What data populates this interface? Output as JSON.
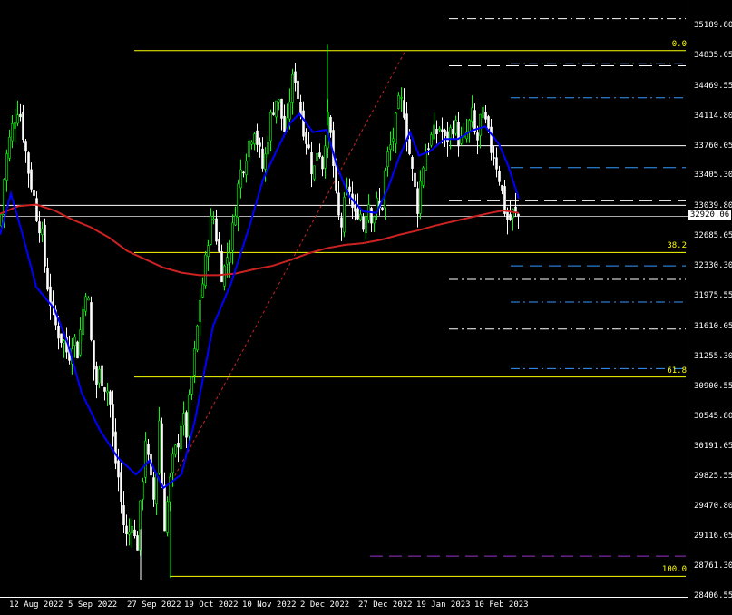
{
  "chart_data": {
    "type": "candlestick",
    "title": "",
    "ylim": [
      28406.55,
      35460
    ],
    "price_axis": {
      "ticks": [
        "35189.80",
        "34835.05",
        "34469.55",
        "34114.80",
        "33760.05",
        "33405.30",
        "33039.80",
        "32685.05",
        "32330.30",
        "31975.55",
        "31610.05",
        "31255.30",
        "30900.55",
        "30545.80",
        "30191.05",
        "29825.55",
        "29470.80",
        "29116.05",
        "28761.30",
        "28406.55"
      ]
    },
    "time_axis": {
      "ticks": [
        "12 Aug 2022",
        "5 Sep 2022",
        "27 Sep 2022",
        "19 Oct 2022",
        "10 Nov 2022",
        "2 Dec 2022",
        "27 Dec 2022",
        "19 Jan 2023",
        "10 Feb 2023"
      ]
    },
    "current_price": "32920.06",
    "fibonacci": {
      "levels": [
        {
          "label": "0.0",
          "price": 34890
        },
        {
          "label": "38.2",
          "price": 32490
        },
        {
          "label": "61.8",
          "price": 31010
        },
        {
          "label": "100.0",
          "price": 28640
        }
      ],
      "color": "#ffff00"
    },
    "horizontal_levels": [
      {
        "price": 35270,
        "style": "dashdot",
        "color": "#ffffff"
      },
      {
        "price": 34740,
        "style": "dashdot",
        "color": "#8899ff"
      },
      {
        "price": 34710,
        "style": "dash",
        "color": "#ffffff"
      },
      {
        "price": 34330,
        "style": "dashdot",
        "color": "#3399ff"
      },
      {
        "price": 33760,
        "style": "solid",
        "color": "#ffffff"
      },
      {
        "price": 33500,
        "style": "dash",
        "color": "#3399ff"
      },
      {
        "price": 33105,
        "style": "dash",
        "color": "#ffffff"
      },
      {
        "price": 33050,
        "style": "solid",
        "color": "#ffffff"
      },
      {
        "price": 32330,
        "style": "dash",
        "color": "#3399ff"
      },
      {
        "price": 32170,
        "style": "dashdot",
        "color": "#ffffff"
      },
      {
        "price": 31900,
        "style": "dashdot",
        "color": "#3399ff"
      },
      {
        "price": 31580,
        "style": "dashdot",
        "color": "#ffffff"
      },
      {
        "price": 31110,
        "style": "dashdot",
        "color": "#3399ff"
      },
      {
        "price": 28880,
        "style": "dash",
        "color": "#9933cc"
      }
    ],
    "colors": {
      "background": "#000000",
      "bull_candle": "#00ff00",
      "bear_candle": "#ffffff",
      "fast_ma": "#0000ff",
      "slow_ma": "#cc2222",
      "trendline": "#cc2222",
      "current_price_line": "#aaaaaa"
    },
    "fast_ma": [
      [
        0,
        32700
      ],
      [
        12,
        33190
      ],
      [
        25,
        32700
      ],
      [
        40,
        32080
      ],
      [
        60,
        31820
      ],
      [
        75,
        31400
      ],
      [
        90,
        30820
      ],
      [
        110,
        30380
      ],
      [
        130,
        30050
      ],
      [
        150,
        29850
      ],
      [
        165,
        30020
      ],
      [
        180,
        29690
      ],
      [
        200,
        29850
      ],
      [
        215,
        30500
      ],
      [
        235,
        31620
      ],
      [
        255,
        32130
      ],
      [
        275,
        32800
      ],
      [
        290,
        33360
      ],
      [
        305,
        33700
      ],
      [
        320,
        34030
      ],
      [
        330,
        34140
      ],
      [
        345,
        33920
      ],
      [
        360,
        33950
      ],
      [
        372,
        33500
      ],
      [
        385,
        33160
      ],
      [
        400,
        32980
      ],
      [
        415,
        32960
      ],
      [
        428,
        33260
      ],
      [
        440,
        33620
      ],
      [
        452,
        33920
      ],
      [
        462,
        33640
      ],
      [
        475,
        33700
      ],
      [
        490,
        33840
      ],
      [
        505,
        33840
      ],
      [
        520,
        33940
      ],
      [
        535,
        33990
      ],
      [
        550,
        33780
      ],
      [
        560,
        33530
      ],
      [
        572,
        33130
      ]
    ],
    "slow_ma": [
      [
        0,
        32950
      ],
      [
        20,
        33040
      ],
      [
        40,
        33060
      ],
      [
        60,
        32990
      ],
      [
        80,
        32880
      ],
      [
        100,
        32790
      ],
      [
        120,
        32670
      ],
      [
        140,
        32510
      ],
      [
        160,
        32410
      ],
      [
        180,
        32310
      ],
      [
        200,
        32250
      ],
      [
        220,
        32220
      ],
      [
        240,
        32220
      ],
      [
        260,
        32240
      ],
      [
        280,
        32290
      ],
      [
        300,
        32330
      ],
      [
        320,
        32400
      ],
      [
        340,
        32480
      ],
      [
        360,
        32540
      ],
      [
        380,
        32580
      ],
      [
        400,
        32600
      ],
      [
        420,
        32640
      ],
      [
        440,
        32700
      ],
      [
        460,
        32750
      ],
      [
        480,
        32810
      ],
      [
        500,
        32860
      ],
      [
        520,
        32910
      ],
      [
        540,
        32960
      ],
      [
        555,
        32990
      ],
      [
        572,
        32960
      ]
    ],
    "candles_anchor_closes": [
      [
        0,
        32800
      ],
      [
        5,
        33520
      ],
      [
        10,
        33820
      ],
      [
        15,
        34080
      ],
      [
        20,
        34260
      ],
      [
        25,
        33920
      ],
      [
        30,
        33520
      ],
      [
        35,
        33260
      ],
      [
        40,
        32960
      ],
      [
        45,
        32760
      ],
      [
        50,
        32240
      ],
      [
        55,
        31920
      ],
      [
        60,
        31640
      ],
      [
        65,
        31520
      ],
      [
        70,
        31420
      ],
      [
        75,
        31250
      ],
      [
        80,
        31520
      ],
      [
        85,
        31320
      ],
      [
        90,
        31720
      ],
      [
        95,
        32170
      ],
      [
        100,
        31420
      ],
      [
        105,
        30900
      ],
      [
        110,
        31080
      ],
      [
        115,
        30920
      ],
      [
        120,
        30820
      ],
      [
        125,
        30120
      ],
      [
        130,
        29820
      ],
      [
        135,
        29320
      ],
      [
        140,
        29050
      ],
      [
        145,
        29350
      ],
      [
        150,
        28900
      ],
      [
        155,
        29550
      ],
      [
        160,
        30300
      ],
      [
        165,
        29800
      ],
      [
        170,
        29500
      ],
      [
        175,
        30500
      ],
      [
        180,
        29200
      ],
      [
        185,
        29600
      ],
      [
        190,
        30000
      ],
      [
        195,
        30200
      ],
      [
        200,
        30550
      ],
      [
        205,
        30350
      ],
      [
        210,
        30900
      ],
      [
        215,
        31350
      ],
      [
        220,
        31950
      ],
      [
        225,
        32250
      ],
      [
        230,
        32800
      ],
      [
        235,
        32900
      ],
      [
        240,
        32550
      ],
      [
        245,
        32200
      ],
      [
        250,
        32450
      ],
      [
        255,
        32650
      ],
      [
        260,
        33150
      ],
      [
        265,
        33450
      ],
      [
        270,
        33650
      ],
      [
        275,
        33850
      ],
      [
        280,
        34000
      ],
      [
        285,
        33700
      ],
      [
        290,
        33450
      ],
      [
        295,
        33900
      ],
      [
        300,
        34200
      ],
      [
        305,
        34350
      ],
      [
        310,
        34100
      ],
      [
        315,
        33850
      ],
      [
        320,
        34450
      ],
      [
        325,
        34600
      ],
      [
        330,
        34200
      ],
      [
        335,
        33950
      ],
      [
        340,
        33700
      ],
      [
        345,
        33400
      ],
      [
        350,
        33800
      ],
      [
        355,
        33550
      ],
      [
        360,
        34100
      ],
      [
        365,
        33800
      ],
      [
        370,
        33100
      ],
      [
        375,
        32750
      ],
      [
        380,
        33100
      ],
      [
        385,
        33250
      ],
      [
        390,
        32850
      ],
      [
        395,
        33050
      ],
      [
        400,
        32800
      ],
      [
        405,
        33150
      ],
      [
        410,
        32900
      ],
      [
        415,
        33050
      ],
      [
        420,
        32950
      ],
      [
        425,
        33550
      ],
      [
        430,
        33750
      ],
      [
        435,
        33950
      ],
      [
        440,
        34300
      ],
      [
        445,
        34200
      ],
      [
        450,
        33750
      ],
      [
        455,
        33350
      ],
      [
        460,
        33050
      ],
      [
        465,
        33500
      ],
      [
        470,
        33750
      ],
      [
        475,
        33850
      ],
      [
        480,
        33900
      ],
      [
        485,
        34000
      ],
      [
        490,
        33800
      ],
      [
        495,
        33900
      ],
      [
        500,
        34050
      ],
      [
        505,
        33850
      ],
      [
        510,
        33750
      ],
      [
        515,
        33950
      ],
      [
        520,
        34100
      ],
      [
        525,
        33750
      ],
      [
        530,
        34150
      ],
      [
        535,
        34000
      ],
      [
        540,
        33750
      ],
      [
        545,
        33650
      ],
      [
        550,
        33400
      ],
      [
        555,
        33050
      ],
      [
        560,
        32850
      ],
      [
        565,
        32950
      ],
      [
        570,
        32920
      ]
    ]
  }
}
